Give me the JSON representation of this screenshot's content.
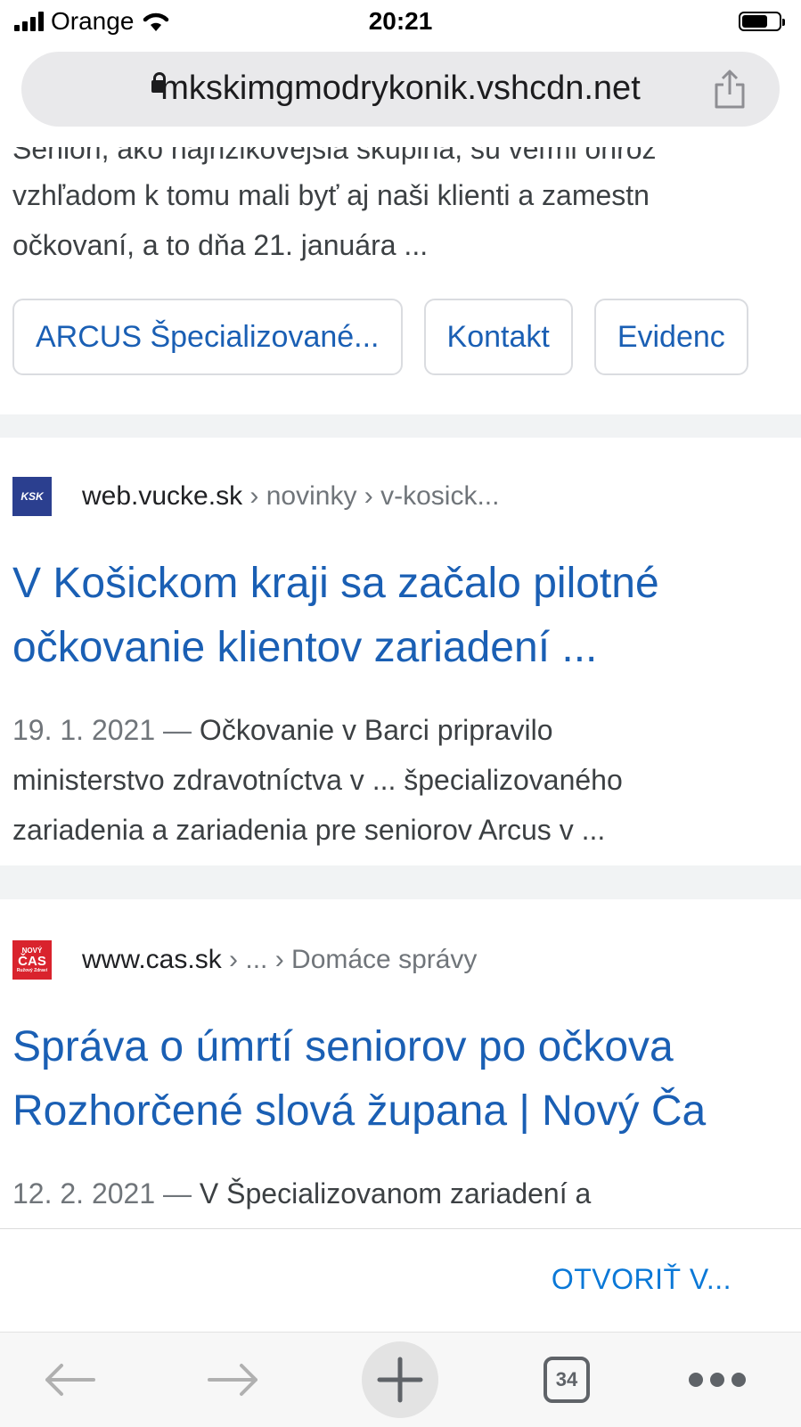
{
  "status_bar": {
    "carrier": "Orange",
    "time": "20:21"
  },
  "url_bar": {
    "url": "mkskimgmodrykonik.vshcdn.net"
  },
  "results": {
    "top_snippet_lines": [
      "Seniori, ako najrizikovejšia skupina, sú veľmi ohroz",
      "vzhľadom k tomu mali byť aj naši klienti a zamestn",
      "očkovaní, a to dňa 21. januára ..."
    ],
    "sitelinks": [
      "ARCUS Špecializované...",
      "Kontakt",
      "Evidenc"
    ],
    "items": [
      {
        "favicon_text": "KSK",
        "domain": "web.vucke.sk",
        "path": " › novinky › v-kosick...",
        "title_lines": [
          "V Košickom kraji sa začalo pilotné",
          "očkovanie klientov zariadení ..."
        ],
        "date": "19. 1. 2021 — ",
        "snippet_first": "Očkovanie v Barci pripravilo",
        "snippet_rest": [
          "ministerstvo zdravotníctva v ... špecializovaného",
          "zariadenia a zariadenia pre seniorov Arcus v ..."
        ]
      },
      {
        "favicon_top": "NOVÝ",
        "favicon_main": "ČAS",
        "favicon_bottom": "Ružový Zdraví",
        "domain": "www.cas.sk",
        "path": " › ... › Domáce správy",
        "title_lines": [
          "Správa o úmrtí seniorov po očkova",
          "Rozhorčené slová župana | Nový Ča"
        ],
        "date": "12. 2. 2021 — ",
        "snippet_first": "V Špecializovanom zariadení a"
      }
    ]
  },
  "banner": {
    "open_in_label": "OTVORIŤ V..."
  },
  "toolbar": {
    "tab_count": "34"
  }
}
